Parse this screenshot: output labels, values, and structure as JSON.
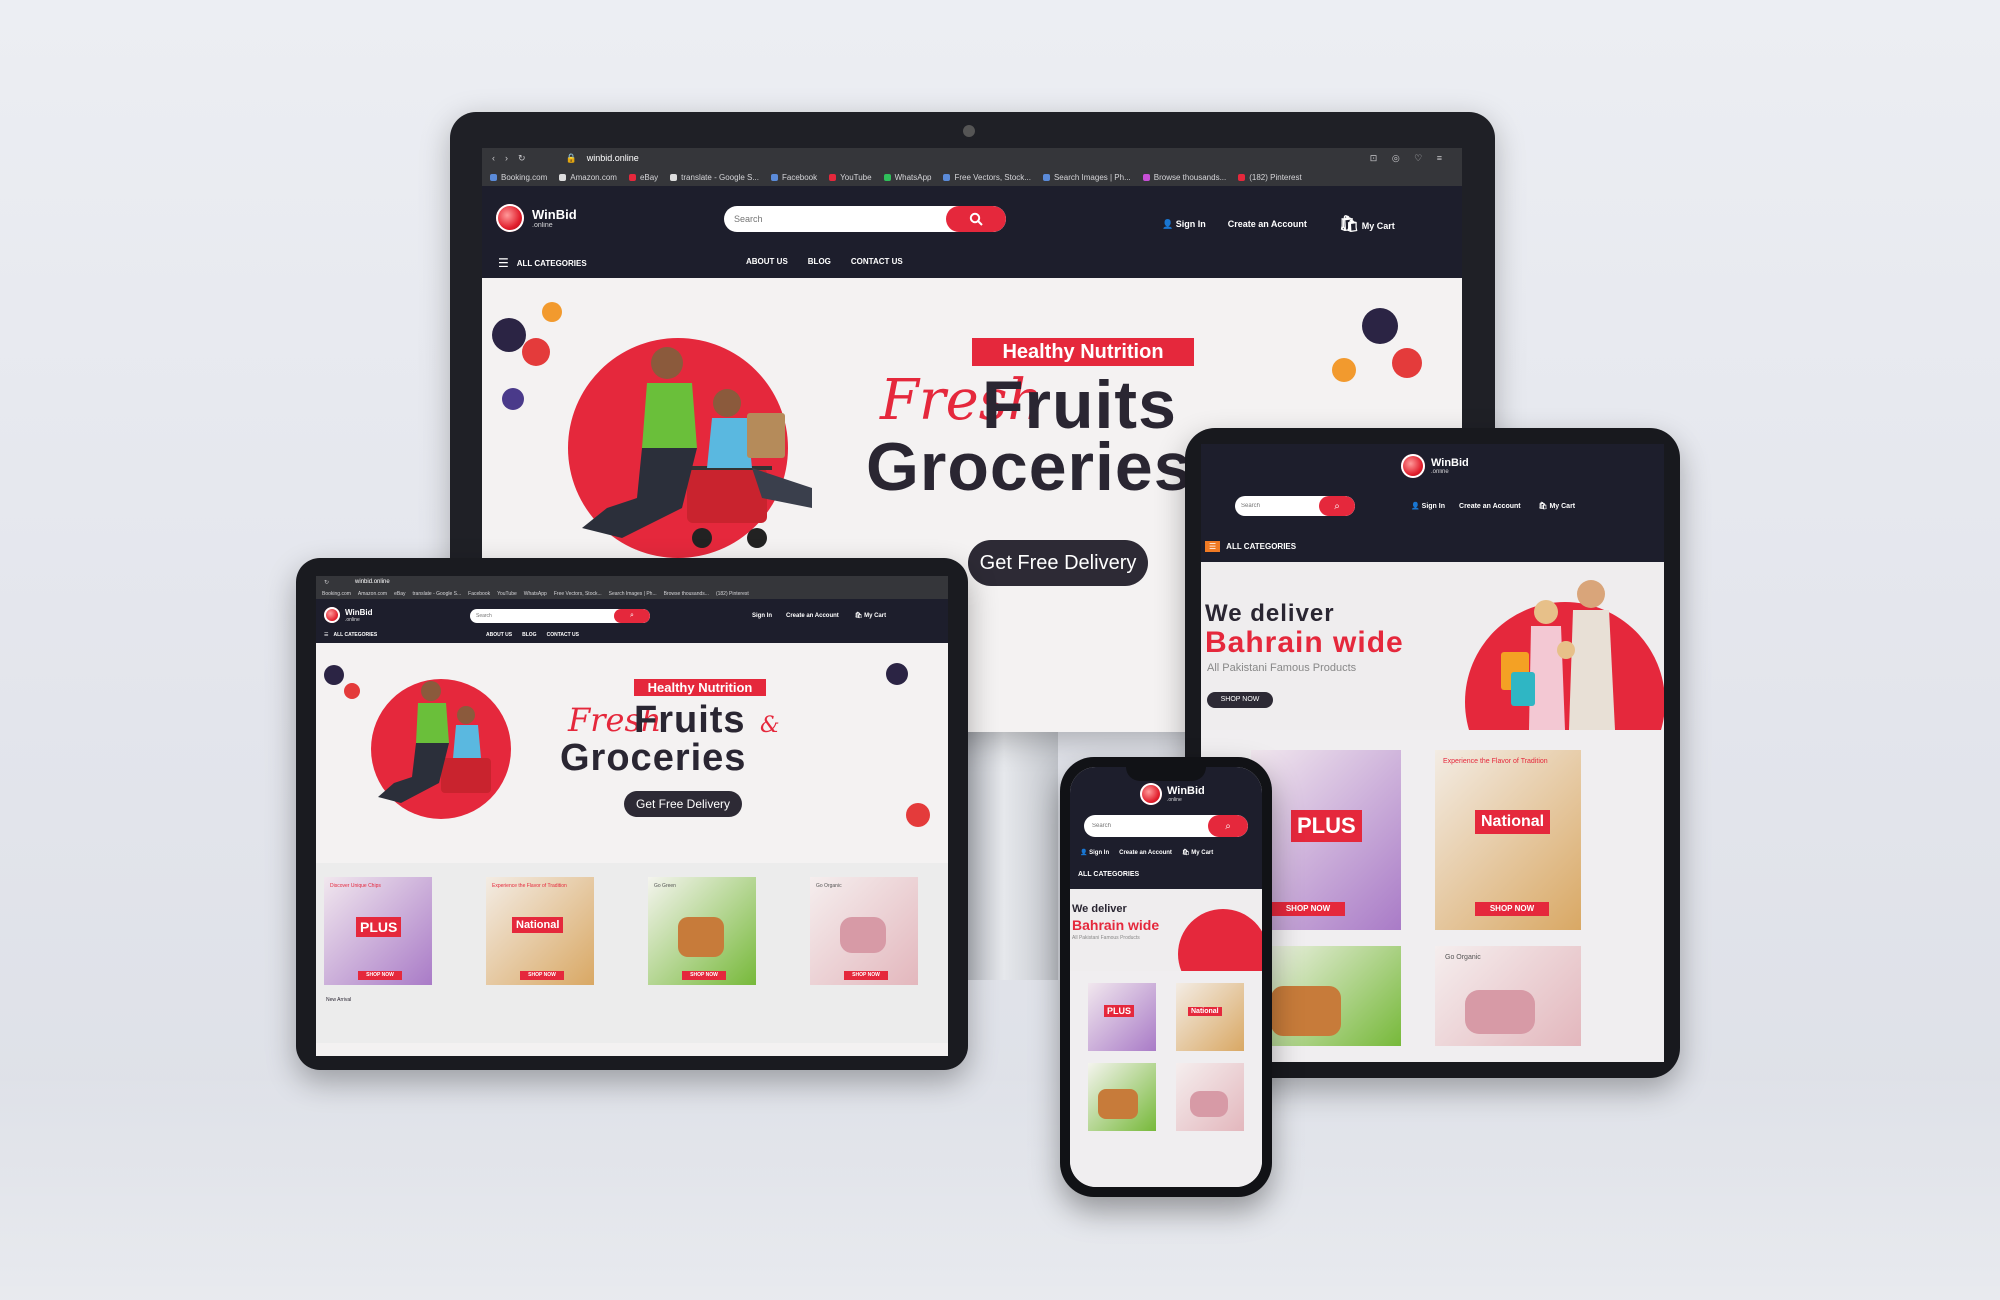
{
  "browser": {
    "url": "winbid.online",
    "bookmarks": [
      "Booking.com",
      "Amazon.com",
      "eBay",
      "translate - Google S...",
      "Facebook",
      "YouTube",
      "WhatsApp",
      "Free Vectors, Stock...",
      "Search Images | Ph...",
      "Browse thousands...",
      "(182) Pinterest"
    ]
  },
  "site": {
    "logo_name": "WinBid",
    "logo_sub": ".online",
    "search_placeholder": "Search",
    "sign_in": "Sign In",
    "create_account": "Create an Account",
    "my_cart": "My Cart",
    "cart_count": "0",
    "all_categories": "ALL CATEGORIES",
    "nav": [
      "ABOUT US",
      "BLOG",
      "CONTACT US"
    ]
  },
  "hero_grocery": {
    "ribbon": "Healthy Nutrition",
    "fresh": "Fresh",
    "line1": "Fruits",
    "amp": "&",
    "line2": "Groceries",
    "cta": "Get Free Delivery"
  },
  "hero_bahrain": {
    "line1": "We deliver",
    "line2": "Bahrain wide",
    "sub": "All Pakistani Famous Products",
    "cta": "SHOP NOW"
  },
  "product_cards": [
    {
      "tag": "Discover Unique Chips",
      "brand": "PLUS",
      "cta": "SHOP NOW"
    },
    {
      "tag": "Experience the Flavor of Tradition",
      "brand": "National",
      "cta": "SHOP NOW"
    },
    {
      "tag": "Go Green",
      "brand": "",
      "cta": "SHOP NOW"
    },
    {
      "tag": "Go Organic",
      "brand": "",
      "cta": "SHOP NOW"
    }
  ],
  "footer_strip": "New Arrival",
  "colors": {
    "brand_red": "#e5283c",
    "header_dark": "#1d1e2c",
    "hero_bg": "#f4f2f2"
  }
}
